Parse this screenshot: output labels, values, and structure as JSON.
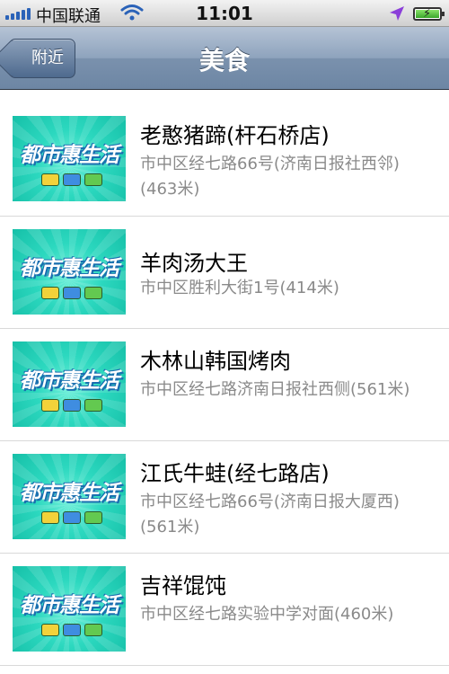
{
  "status_bar": {
    "carrier": "中国联通",
    "time": "11:01"
  },
  "nav": {
    "back_label": "附近",
    "title": "美食"
  },
  "thumbnail_text": "都市惠生活",
  "items": [
    {
      "name": "老憨猪蹄(杆石桥店)",
      "address": "市中区经七路66号(济南日报社西邻)(463米)"
    },
    {
      "name": "羊肉汤大王",
      "address": "市中区胜利大街1号(414米)"
    },
    {
      "name": "木林山韩国烤肉",
      "address": "市中区经七路济南日报社西侧(561米)"
    },
    {
      "name": "江氏牛蛙(经七路店)",
      "address": "市中区经七路66号(济南日报大厦西)(561米)"
    },
    {
      "name": "吉祥馄饨",
      "address": "市中区经七路实验中学对面(460米)"
    }
  ],
  "colors": {
    "nav_bar": "#7a91ad",
    "thumbnail_bg": "#2cd8bf",
    "address_text": "#8a8a8a"
  }
}
